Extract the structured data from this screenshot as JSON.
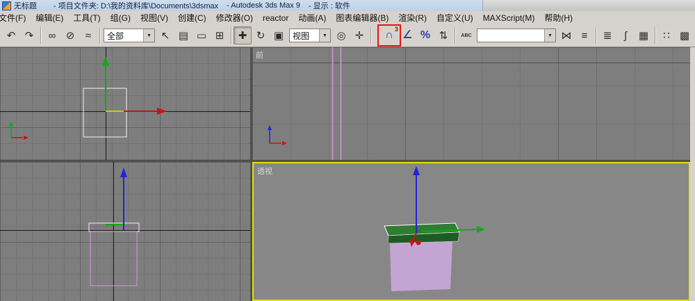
{
  "window": {
    "title_doc": "无标题",
    "title_project": "- 项目文件夹: D:\\我的资料库\\Documents\\3dsmax",
    "title_app": "- Autodesk 3ds Max 9",
    "title_display": "- 显示 : 软件"
  },
  "menu": {
    "items": [
      "文件(F)",
      "编辑(E)",
      "工具(T)",
      "组(G)",
      "视图(V)",
      "创建(C)",
      "修改器(O)",
      "reactor",
      "动画(A)",
      "图表编辑器(B)",
      "渲染(R)",
      "自定义(U)",
      "MAXScript(M)",
      "帮助(H)"
    ]
  },
  "toolbar": {
    "selection_filter": "全部",
    "coordinate_system": "视图",
    "named_selection_value": "",
    "snap_badge": "3",
    "icons": {
      "dropdown_arrow": "▼",
      "undo": "↶",
      "redo": "↷",
      "link": "∞",
      "unlink": "⊘",
      "bind": "≈",
      "select": "↖",
      "select_by_name": "▤",
      "region": "▭",
      "window_crossing": "⊞",
      "move": "✚",
      "rotate": "↻",
      "scale": "▣",
      "use_center": "◎",
      "manipulate": "✛",
      "snap": "∩",
      "angle_snap": "∠",
      "percent_snap": "%",
      "spinner_snap": "⇅",
      "named_sel": "ABC",
      "mirror": "⋈",
      "align": "≡",
      "layers": "≣",
      "curve_editor": "∫",
      "schematic": "▦",
      "material_editor": "∷",
      "render_setup": "▩",
      "quick_render": "◉"
    }
  },
  "viewports": {
    "front_label": "前",
    "perspective_label": "透视"
  },
  "colors": {
    "titlebar_bg": "#bcd2e8",
    "chrome_bg": "#d6d3ce",
    "viewport_bg": "#7e7e7e",
    "grid_minor": "#717171",
    "grid_major": "#5f5f5f",
    "active_border": "#e3e300",
    "annotation": "#e41414",
    "axis_x": "#cc1111",
    "axis_y": "#11aa11",
    "axis_z": "#2222dd",
    "gizmo_plane": "#cccc00",
    "object_pink": "#d29ad2",
    "box_top_green": "#2e7d32",
    "box_front_green": "#1d5c24",
    "box_body": "#c3a4d2"
  }
}
